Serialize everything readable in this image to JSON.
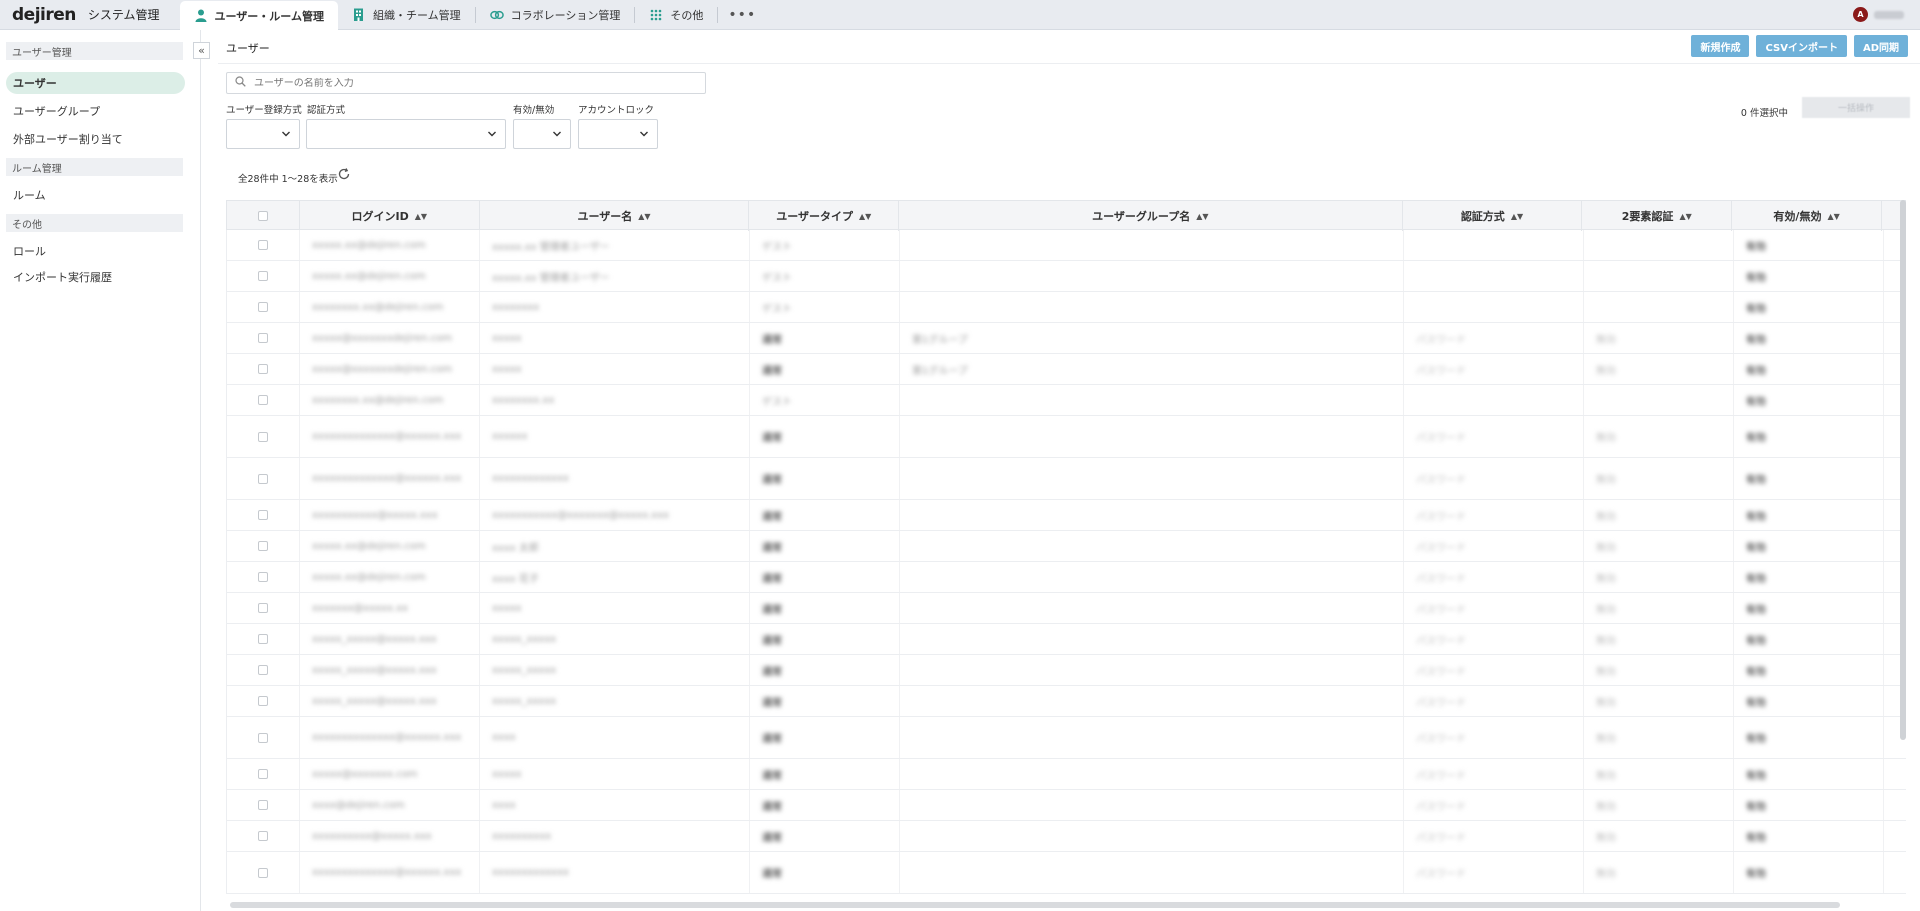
{
  "header": {
    "logo": "dejiren",
    "app_title": "システム管理",
    "tabs": [
      {
        "label": "ユーザー・ルーム管理",
        "icon": "user-icon",
        "active": true
      },
      {
        "label": "組織・チーム管理",
        "icon": "building-icon",
        "active": false
      },
      {
        "label": "コラボレーション管理",
        "icon": "link-icon",
        "active": false
      },
      {
        "label": "その他",
        "icon": "grid-icon",
        "active": false
      }
    ],
    "more": "•••",
    "avatar_initial": "A"
  },
  "sidebar": {
    "sections": [
      {
        "title": "ユーザー管理",
        "items": [
          "ユーザー",
          "ユーザーグループ",
          "外部ユーザー割り当て"
        ]
      },
      {
        "title": "ルーム管理",
        "items": [
          "ルーム"
        ]
      },
      {
        "title": "その他",
        "items": [
          "ロール",
          "インポート実行履歴"
        ]
      }
    ],
    "collapse": "«"
  },
  "main": {
    "title": "ユーザー",
    "buttons": {
      "create": "新規作成",
      "csv_import": "CSVインポート",
      "ad_sync": "AD同期"
    },
    "search_placeholder": "ユーザーの名前を入力",
    "filters": {
      "reg_method": "ユーザー登録方式",
      "auth_method": "認証方式",
      "valid": "有効/無効",
      "lock": "アカウントロック"
    },
    "selected_count": "0 件選択中",
    "bulk_action": "一括操作",
    "count_text": "全28件中 1〜28を表示"
  },
  "table": {
    "columns": [
      "ログインID",
      "ユーザー名",
      "ユーザータイプ",
      "ユーザーグループ名",
      "認証方式",
      "2要素認証",
      "有効/無効"
    ],
    "rows": [
      [
        "xxxxx.xx@dejiren.com",
        "xxxxx.xx 管理者ユーザー",
        "ゲスト",
        "",
        "",
        "",
        "有効"
      ],
      [
        "xxxxx.xx@dejiren.com",
        "xxxxx.xx 管理者ユーザー",
        "ゲスト",
        "",
        "",
        "",
        "有効"
      ],
      [
        "xxxxxxxx.xx@dejiren.com",
        "xxxxxxxx",
        "ゲスト",
        "",
        "",
        "",
        "有効"
      ],
      [
        "xxxxx@xxxxxxxdejiren.com",
        "xxxxx",
        "通常",
        "第1グループ",
        "パスワード",
        "無効",
        "有効"
      ],
      [
        "xxxxx@xxxxxxxdejiren.com",
        "xxxxx",
        "通常",
        "第1グループ",
        "パスワード",
        "無効",
        "有効"
      ],
      [
        "xxxxxxxx.xx@dejiren.com",
        "xxxxxxxx.xx",
        "ゲスト",
        "",
        "",
        "",
        "有効"
      ],
      [
        "xxxxxxxxxxxxxx@xxxxxx.xxx",
        "xxxxxx",
        "通常",
        "",
        "パスワード",
        "無効",
        "有効"
      ],
      [
        "xxxxxxxxxxxxxx@xxxxxx.xxx",
        "xxxxxxxxxxxxx",
        "通常",
        "",
        "パスワード",
        "無効",
        "有効"
      ],
      [
        "xxxxxxxxxxx@xxxxx.xxx",
        "xxxxxxxxxxx@xxxxxxx@xxxxx.xxx",
        "通常",
        "",
        "パスワード",
        "無効",
        "有効"
      ],
      [
        "xxxxx.xx@dejiren.com",
        "xxxx 太郎",
        "通常",
        "",
        "パスワード",
        "無効",
        "有効"
      ],
      [
        "xxxxx.xx@dejiren.com",
        "xxxx 花子",
        "通常",
        "",
        "パスワード",
        "無効",
        "有効"
      ],
      [
        "xxxxxxx@xxxxx.xx",
        "xxxxx",
        "通常",
        "",
        "パスワード",
        "無効",
        "有効"
      ],
      [
        "xxxxx_xxxxx@xxxxx.xxx",
        "xxxxx_xxxxx",
        "通常",
        "",
        "パスワード",
        "無効",
        "有効"
      ],
      [
        "xxxxx_xxxxx@xxxxx.xxx",
        "xxxxx_xxxxx",
        "通常",
        "",
        "パスワード",
        "無効",
        "有効"
      ],
      [
        "xxxxx_xxxxx@xxxxx.xxx",
        "xxxxx_xxxxx",
        "通常",
        "",
        "パスワード",
        "無効",
        "有効"
      ],
      [
        "xxxxxxxxxxxxxx@xxxxxx.xxx",
        "xxxx",
        "通常",
        "",
        "パスワード",
        "無効",
        "有効"
      ],
      [
        "xxxxx@xxxxxxx.com",
        "xxxxx",
        "通常",
        "",
        "パスワード",
        "無効",
        "有効"
      ],
      [
        "xxxx@dejiren.com",
        "xxxx",
        "通常",
        "",
        "パスワード",
        "無効",
        "有効"
      ],
      [
        "xxxxxxxxxx@xxxxx.xxx",
        "xxxxxxxxxx",
        "通常",
        "",
        "パスワード",
        "無効",
        "有効"
      ],
      [
        "xxxxxxxxxxxxxx@xxxxxx.xxx",
        "xxxxxxxxxxxxx",
        "通常",
        "",
        "パスワード",
        "無効",
        "有効"
      ]
    ]
  }
}
